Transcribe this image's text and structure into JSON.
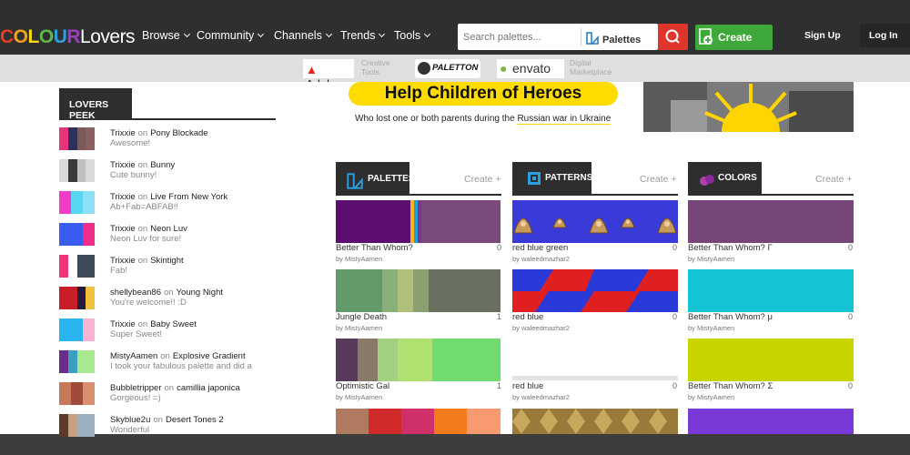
{
  "header": {
    "logo_letters": [
      "C",
      "O",
      "L",
      "O",
      "U",
      "R"
    ],
    "logo_colors": [
      "#e63c2f",
      "#f0a21b",
      "#f5d90b",
      "#5cb947",
      "#2d9ee0",
      "#9b3fbf"
    ],
    "logo_tail": "Lovers",
    "nav": [
      "Browse",
      "Community",
      "Channels",
      "Trends",
      "Tools"
    ],
    "search_placeholder": "Search palettes...",
    "search_type": "Palettes",
    "create_label": "Create",
    "signup_label": "Sign Up",
    "login_label": "Log In"
  },
  "sponsors": {
    "adobe_name": "Adobe",
    "adobe_sub1": "Creative",
    "adobe_sub2": "Tools",
    "paletton_name": "PALETTON",
    "envato_name": "envato",
    "envato_sub1": "Digital",
    "envato_sub2": "Marketplace"
  },
  "ad": {
    "headline": "Help Children of Heroes",
    "sub_a": "Who lost one or both parents during the ",
    "sub_b": "Russian war in Ukraine"
  },
  "peek": {
    "title": "LOVERS PEEK",
    "items": [
      {
        "user": "Trixxie",
        "on": "on",
        "target": "Pony Blockade",
        "comment": "Awesome!",
        "colors": [
          "#e8357a",
          "#2f2f5c",
          "#7d5a5a",
          "#8a6060"
        ]
      },
      {
        "user": "Trixxie",
        "on": "on",
        "target": "Bunny",
        "comment": "Cute bunny!",
        "colors": [
          "#d9d9d9",
          "#3a3a3a",
          "#bfbfbf",
          "#d9d9d9"
        ]
      },
      {
        "user": "Trixxie",
        "on": "on",
        "target": "Live From New York",
        "comment": "Ab+Fab=ABFAB!!",
        "colors": [
          "#f03cc8",
          "#5ad7f0",
          "#8ce1f5"
        ]
      },
      {
        "user": "Trixxie",
        "on": "on",
        "target": "Neon Luv",
        "comment": "Neon Luv for sure!",
        "colors": [
          "#3b5cf0",
          "#3b5cf0",
          "#f02e8a"
        ]
      },
      {
        "user": "Trixxie",
        "on": "on",
        "target": "Skintight",
        "comment": "Fab!",
        "colors": [
          "#f0357a",
          "#ffffff",
          "#3d4a5a",
          "#3d4a5a"
        ]
      },
      {
        "user": "shellybean86",
        "on": "on",
        "target": "Young Night",
        "comment": "You're welcome!! :D",
        "colors": [
          "#c81e2a",
          "#c81e2a",
          "#2a1a3a",
          "#f0c040"
        ]
      },
      {
        "user": "Trixxie",
        "on": "on",
        "target": "Baby Sweet",
        "comment": "Super Sweet!",
        "colors": [
          "#2ab4f0",
          "#2ab4f0",
          "#f8b4d0"
        ]
      },
      {
        "user": "MistyAamen",
        "on": "on",
        "target": "Explosive Gradient",
        "comment": "I took your fabulous palette and did a",
        "colors": [
          "#6a2c8a",
          "#3aa0c0",
          "#a8e890",
          "#a8e890"
        ]
      },
      {
        "user": "Bubbletripper",
        "on": "on",
        "target": "camillia japonica",
        "comment": "Gorgeous! =)",
        "colors": [
          "#c8785a",
          "#a04a3a",
          "#d89070"
        ]
      },
      {
        "user": "Skyblue2u",
        "on": "on",
        "target": "Desert Tones 2",
        "comment": "Wonderful",
        "colors": [
          "#5a3a2a",
          "#c8a080",
          "#9ab0c0",
          "#9ab0c0"
        ]
      }
    ]
  },
  "columns": [
    {
      "key": "palettes",
      "title": "PALETTES",
      "create": "Create +"
    },
    {
      "key": "patterns",
      "title": "PATTERNS",
      "create": "Create +"
    },
    {
      "key": "colors",
      "title": "COLORS",
      "create": "Create +"
    }
  ],
  "palettes": [
    {
      "name": "Better Than Whom?",
      "by": "by MistyAamen",
      "count": "0",
      "colors": [
        [
          "#5c0f70",
          82
        ],
        [
          "#f5b81b",
          4
        ],
        [
          "#1fa0d8",
          4
        ],
        [
          "#7a3a8a",
          4
        ],
        [
          "#7a4a7a",
          87
        ]
      ]
    },
    {
      "name": "Jungle Death",
      "by": "by MistyAamen",
      "count": "1",
      "colors": [
        [
          "#629a6a",
          51
        ],
        [
          "#8ab07a",
          17
        ],
        [
          "#b0c07a",
          17
        ],
        [
          "#8aa070",
          17
        ],
        [
          "#6a7060",
          79
        ]
      ]
    },
    {
      "name": "Optimistic Gal",
      "by": "by MistyAamen",
      "count": "1",
      "colors": [
        [
          "#5a3a5a",
          24
        ],
        [
          "#8a7a6a",
          22
        ],
        [
          "#a0d080",
          22
        ],
        [
          "#b0e070",
          38
        ],
        [
          "#70dc70",
          75
        ]
      ]
    },
    {
      "name": "",
      "by": "",
      "count": "",
      "colors": [
        [
          "#b07a60",
          36
        ],
        [
          "#d02a2a",
          36
        ],
        [
          "#d0306a",
          36
        ],
        [
          "#f57a1b",
          36
        ],
        [
          "#f79a70",
          37
        ]
      ]
    }
  ],
  "patterns": [
    {
      "name": "red blue green",
      "by": "by waleedmazhar2",
      "count": "0"
    },
    {
      "name": "red blue",
      "by": "by waleedmazhar2",
      "count": "0"
    },
    {
      "name": "red blue",
      "by": "by waleedmazhar2",
      "count": "0"
    }
  ],
  "colors": [
    {
      "name": "Better Than Whom? Г",
      "by": "by MistyAamen",
      "count": "0",
      "hex": "#76457a"
    },
    {
      "name": "Better Than Whom? μ",
      "by": "by MistyAamen",
      "count": "0",
      "hex": "#14c4d4"
    },
    {
      "name": "Better Than Whom? Σ",
      "by": "by MistyAamen",
      "count": "0",
      "hex": "#c8d400"
    },
    {
      "name": "",
      "by": "",
      "count": "",
      "hex": "#7a3ad8"
    }
  ]
}
